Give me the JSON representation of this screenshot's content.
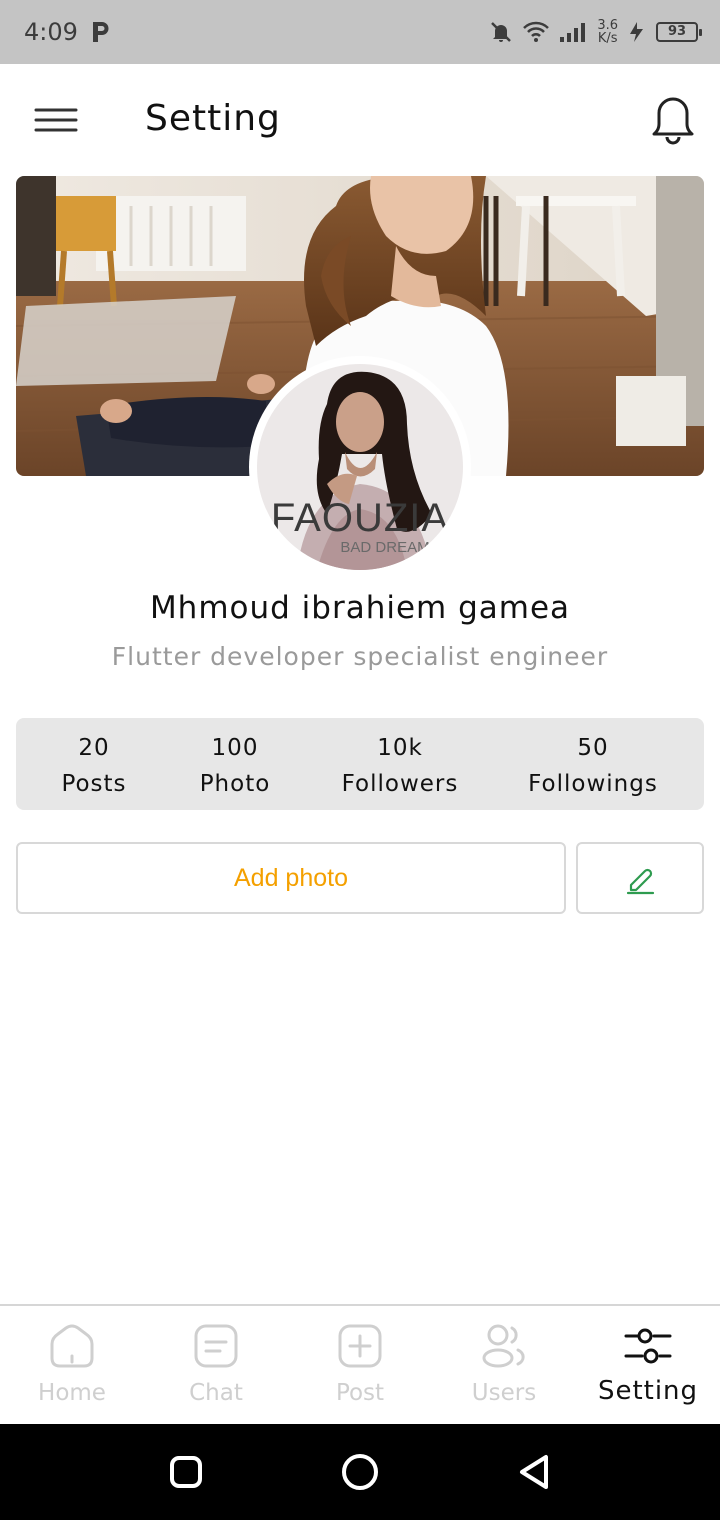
{
  "status_bar": {
    "time": "4:09",
    "net_speed_value": "3.6",
    "net_speed_unit": "K/s",
    "battery": "93"
  },
  "app_bar": {
    "title": "Setting"
  },
  "profile": {
    "avatar_text": "FAOUZIA",
    "avatar_subtext": "BAD DREAM",
    "name": "Mhmoud ibrahiem gamea",
    "bio": "Flutter developer specialist engineer"
  },
  "stats": [
    {
      "value": "20",
      "label": "Posts"
    },
    {
      "value": "100",
      "label": "Photo"
    },
    {
      "value": "10k",
      "label": "Followers"
    },
    {
      "value": "50",
      "label": "Followings"
    }
  ],
  "actions": {
    "add_photo_label": "Add photo",
    "edit_icon": "pencil-icon"
  },
  "bottom_nav": {
    "items": [
      {
        "label": "Home",
        "icon": "home-icon"
      },
      {
        "label": "Chat",
        "icon": "chat-icon"
      },
      {
        "label": "Post",
        "icon": "add-post-icon"
      },
      {
        "label": "Users",
        "icon": "users-icon"
      },
      {
        "label": "Setting",
        "icon": "settings-sliders-icon"
      }
    ],
    "active": "Setting"
  },
  "colors": {
    "accent": "#f4a000",
    "edit_icon": "#2e9b4f",
    "inactive_nav": "#cfcfcf",
    "status_bar_bg": "#c4c4c4",
    "stats_bg": "#e7e7e7"
  }
}
